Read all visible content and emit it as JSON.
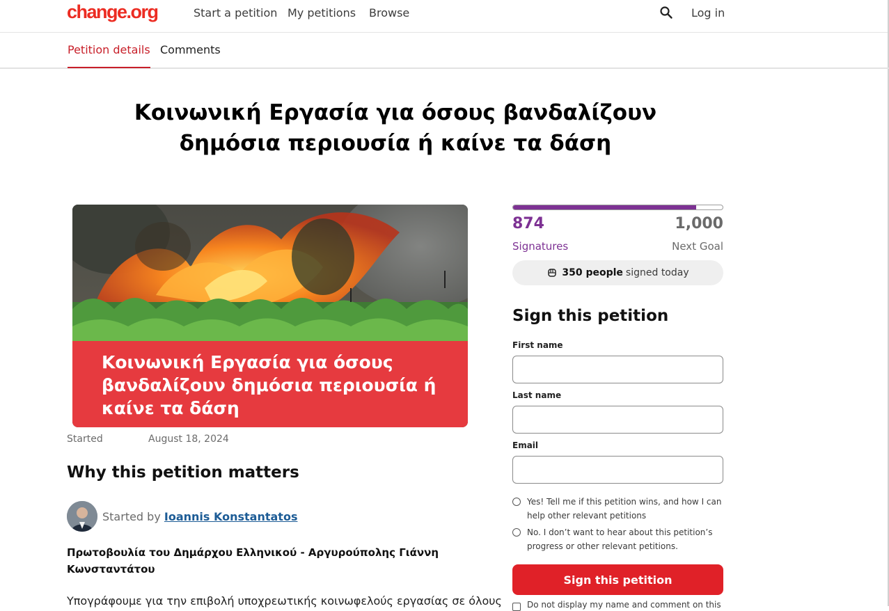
{
  "header": {
    "logo": "change.org",
    "nav": [
      "Start a petition",
      "My petitions",
      "Browse"
    ],
    "login": "Log in"
  },
  "tabs": [
    "Petition details",
    "Comments"
  ],
  "petition": {
    "title": "Κοινωνική Εργασία για όσους βανδαλίζουν δημόσια περιουσία ή καίνε τα δάση",
    "image_caption": "Κοινωνική Εργασία για όσους βανδαλίζουν δημόσια περιουσία ή καίνε τα δάση",
    "started_label": "Started",
    "started_date": "August 18, 2024",
    "why_heading": "Why this petition matters",
    "started_by_prefix": "Started by",
    "author": "Ioannis Konstantatos",
    "intro_bold": "Πρωτοβουλία του Δημάρχου Ελληνικού - Αργυρούπολης Γιάννη Κωνσταντάτου",
    "intro_body": "Υπογράφουμε για την επιβολή υποχρεωτικής κοινωφελούς εργασίας σε όλους"
  },
  "progress": {
    "signatures": "874",
    "signatures_label": "Signatures",
    "goal": "1,000",
    "goal_label": "Next Goal",
    "fraction": 0.874,
    "color": "#7d3193"
  },
  "today": {
    "count": "350 people",
    "suffix": "signed today",
    "icon": "fist-icon"
  },
  "form": {
    "heading": "Sign this petition",
    "first_name_label": "First name",
    "last_name_label": "Last name",
    "email_label": "Email",
    "first_name_value": "",
    "last_name_value": "",
    "email_value": "",
    "option_yes": "Yes! Tell me if this petition wins, and how I can help other relevant petitions",
    "option_no": "No. I don’t want to hear about this petition’s progress or other relevant petitions.",
    "submit": "Sign this petition",
    "checkbox_text": "Do not display my name and comment on this"
  },
  "colors": {
    "brand": "#ec2c22",
    "button": "#e02128",
    "accent": "#7d3193",
    "link": "#1d5c96"
  }
}
